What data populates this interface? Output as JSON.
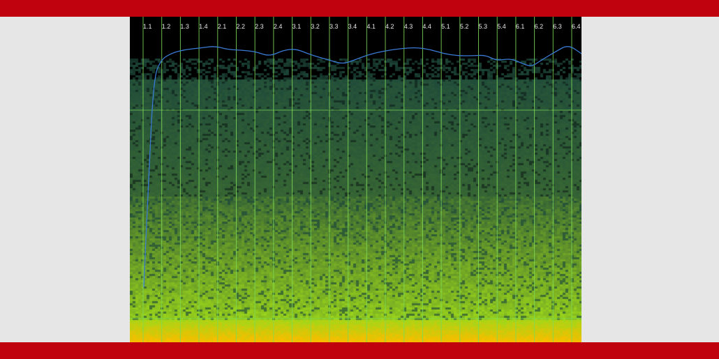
{
  "app": {
    "frame_color": "#c0020f",
    "background_color": "#e6e6e6"
  },
  "spectrogram": {
    "beat_labels": [
      "1.1",
      "1.2",
      "1.3",
      "1.4",
      "2.1",
      "2.2",
      "2.3",
      "2.4",
      "3.1",
      "3.2",
      "3.3",
      "3.4",
      "4.1",
      "4.2",
      "4.3",
      "4.4",
      "5.1",
      "5.2",
      "5.3",
      "5.4",
      "6.1",
      "6.2",
      "6.3",
      "6.4"
    ],
    "grid_line_color": "#7ed957",
    "curve_color": "#3a7bd5",
    "color_low": "#0a1410",
    "color_mid": "#1e4a3a",
    "color_high": "#9ed81a",
    "color_peak": "#f0c000"
  }
}
